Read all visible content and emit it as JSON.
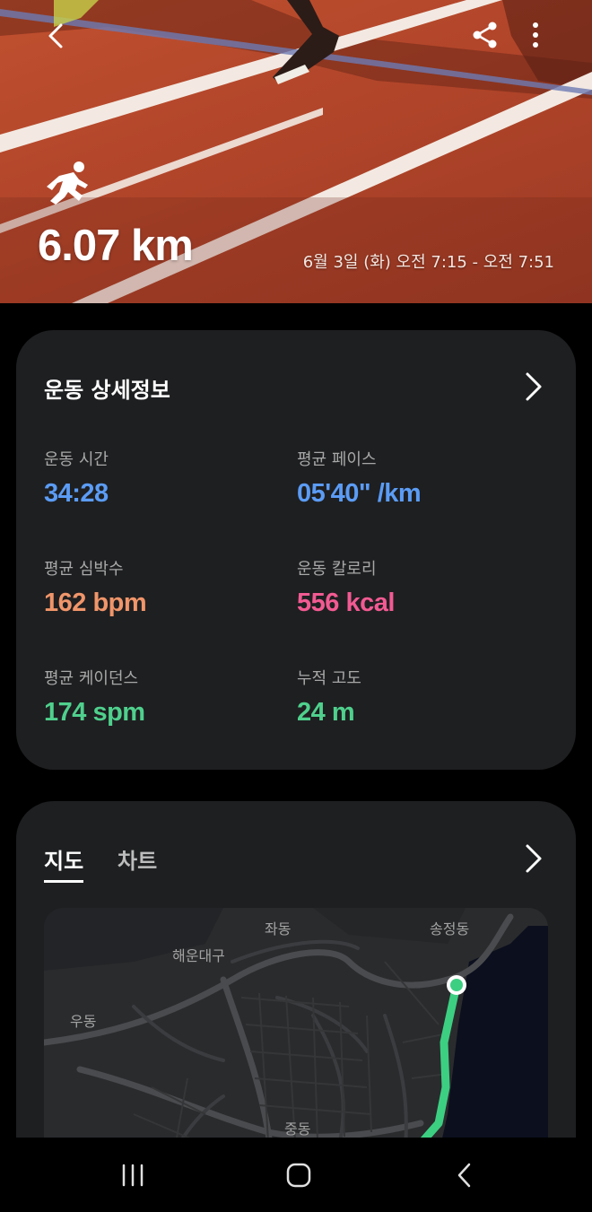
{
  "header": {
    "distance": "6.07 km",
    "datetime": "6월 3일 (화) 오전 7:15 - 오전 7:51"
  },
  "details": {
    "title": "운동 상세정보",
    "stats": [
      {
        "label": "운동 시간",
        "value": "34:28",
        "color": "#5b9cf5"
      },
      {
        "label": "평균 페이스",
        "value": "05'40\" /km",
        "color": "#5b9cf5"
      },
      {
        "label": "평균 심박수",
        "value": "162 bpm",
        "color": "#f0956a"
      },
      {
        "label": "운동 칼로리",
        "value": "556 kcal",
        "color": "#f25a92"
      },
      {
        "label": "평균 케이던스",
        "value": "174 spm",
        "color": "#4fd08d"
      },
      {
        "label": "누적 고도",
        "value": "24 m",
        "color": "#4fd08d"
      }
    ]
  },
  "map_section": {
    "tabs": [
      "지도",
      "차트"
    ],
    "active_tab": "지도",
    "labels": [
      "좌동",
      "송정동",
      "해운대구",
      "우동",
      "중동"
    ],
    "route_color": "#3ccf82"
  },
  "navbar": {
    "buttons": [
      "recent-apps",
      "home",
      "back"
    ]
  }
}
